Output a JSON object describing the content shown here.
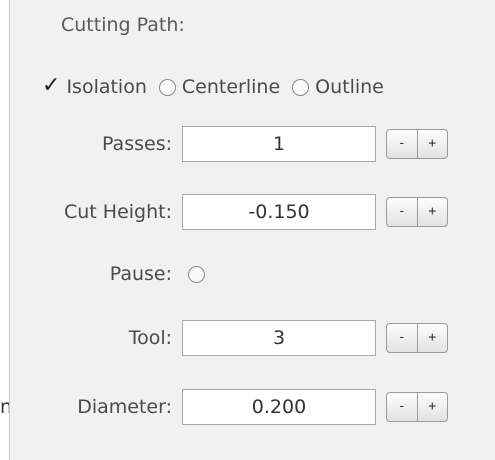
{
  "stray_char": "n",
  "section": {
    "title": "Cutting Path:"
  },
  "cutting_path": {
    "options": [
      {
        "label": "Isolation",
        "selected": true
      },
      {
        "label": "Centerline",
        "selected": false
      },
      {
        "label": "Outline",
        "selected": false
      }
    ]
  },
  "stepper": {
    "minus": "-",
    "plus": "+"
  },
  "fields": {
    "passes": {
      "label": "Passes:",
      "value": "1"
    },
    "cut_height": {
      "label": "Cut Height:",
      "value": "-0.150"
    },
    "pause": {
      "label": "Pause:",
      "checked": false
    },
    "tool": {
      "label": "Tool:",
      "value": "3"
    },
    "diameter": {
      "label": "Diameter:",
      "value": "0.200"
    }
  }
}
